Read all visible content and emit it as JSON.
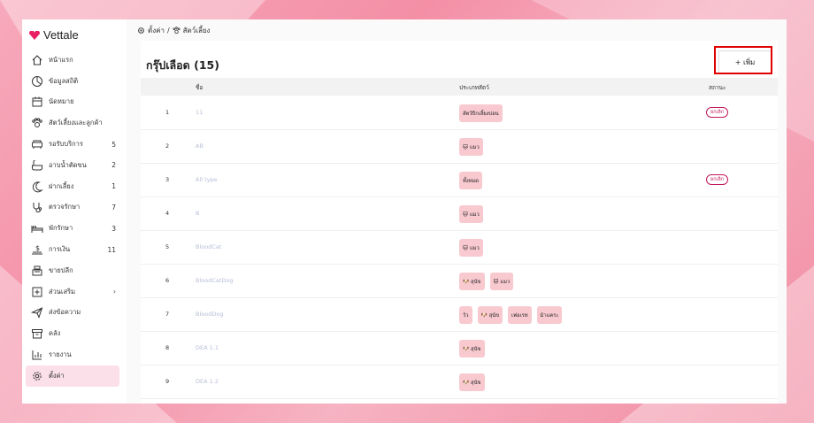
{
  "app": {
    "logo_text": "Vettale"
  },
  "sidebar": {
    "items": [
      {
        "label": "หน้าแรก",
        "icon": "home-icon",
        "badge": ""
      },
      {
        "label": "ข้อมูลสถิติ",
        "icon": "stats-icon",
        "badge": ""
      },
      {
        "label": "นัดหมาย",
        "icon": "calendar-icon",
        "badge": ""
      },
      {
        "label": "สัตว์เลี้ยงและลูกค้า",
        "icon": "paw-icon",
        "badge": ""
      },
      {
        "label": "รอรับบริการ",
        "icon": "sofa-icon",
        "badge": "5"
      },
      {
        "label": "อาบน้ำตัดขน",
        "icon": "bath-icon",
        "badge": "2"
      },
      {
        "label": "ฝากเลี้ยง",
        "icon": "moon-icon",
        "badge": "1"
      },
      {
        "label": "ตรวจรักษา",
        "icon": "stethoscope-icon",
        "badge": "7"
      },
      {
        "label": "พักรักษา",
        "icon": "bed-icon",
        "badge": "3"
      },
      {
        "label": "การเงิน",
        "icon": "money-icon",
        "badge": "11"
      },
      {
        "label": "ขายปลีก",
        "icon": "register-icon",
        "badge": ""
      },
      {
        "label": "ส่วนเสริม",
        "icon": "plus-box-icon",
        "badge": "›"
      },
      {
        "label": "ส่งข้อความ",
        "icon": "send-icon",
        "badge": ""
      },
      {
        "label": "คลัง",
        "icon": "archive-icon",
        "badge": ""
      },
      {
        "label": "รายงาน",
        "icon": "chart-icon",
        "badge": ""
      },
      {
        "label": "ตั้งค่า",
        "icon": "gear-icon",
        "badge": "",
        "active": true
      }
    ]
  },
  "breadcrumb": {
    "root": "ตั้งค่า",
    "separator": "/",
    "current": "สัตว์เลี้ยง"
  },
  "page": {
    "title": "กรุ๊ปเลือด (15)",
    "add_button": "+ เพิ่ม"
  },
  "table": {
    "headers": {
      "name": "ชื่อ",
      "category": "ประเภทสัตว์",
      "status": "สถานะ"
    },
    "rows": [
      {
        "num": "1",
        "name": "11",
        "cats": [
          "สัตว์ปีกเลี้ยงบ่อน"
        ],
        "status": "ยกเลิก"
      },
      {
        "num": "2",
        "name": "AB",
        "cats": [
          "🐱 แมว"
        ],
        "status": ""
      },
      {
        "num": "3",
        "name": "All type",
        "cats": [
          "ทั้งหมด"
        ],
        "status": "ยกเลิก"
      },
      {
        "num": "4",
        "name": "B",
        "cats": [
          "🐱 แมว"
        ],
        "status": ""
      },
      {
        "num": "5",
        "name": "BloodCat",
        "cats": [
          "🐱 แมว"
        ],
        "status": ""
      },
      {
        "num": "6",
        "name": "BloodCatDog",
        "cats": [
          "🐶 สุนัข",
          "🐱 แมว"
        ],
        "status": ""
      },
      {
        "num": "7",
        "name": "BloodDog",
        "cats": [
          "วัว",
          "🐶 สุนัข",
          "เฟอเรท",
          "ม้าแคระ"
        ],
        "status": ""
      },
      {
        "num": "8",
        "name": "DEA 1.1",
        "cats": [
          "🐶 สุนัข"
        ],
        "status": ""
      },
      {
        "num": "9",
        "name": "DEA 1.2",
        "cats": [
          "🐶 สุนัข"
        ],
        "status": ""
      }
    ]
  },
  "colors": {
    "accent": "#e91e63",
    "chip": "#f8c9cf",
    "highlight": "#e00000"
  }
}
